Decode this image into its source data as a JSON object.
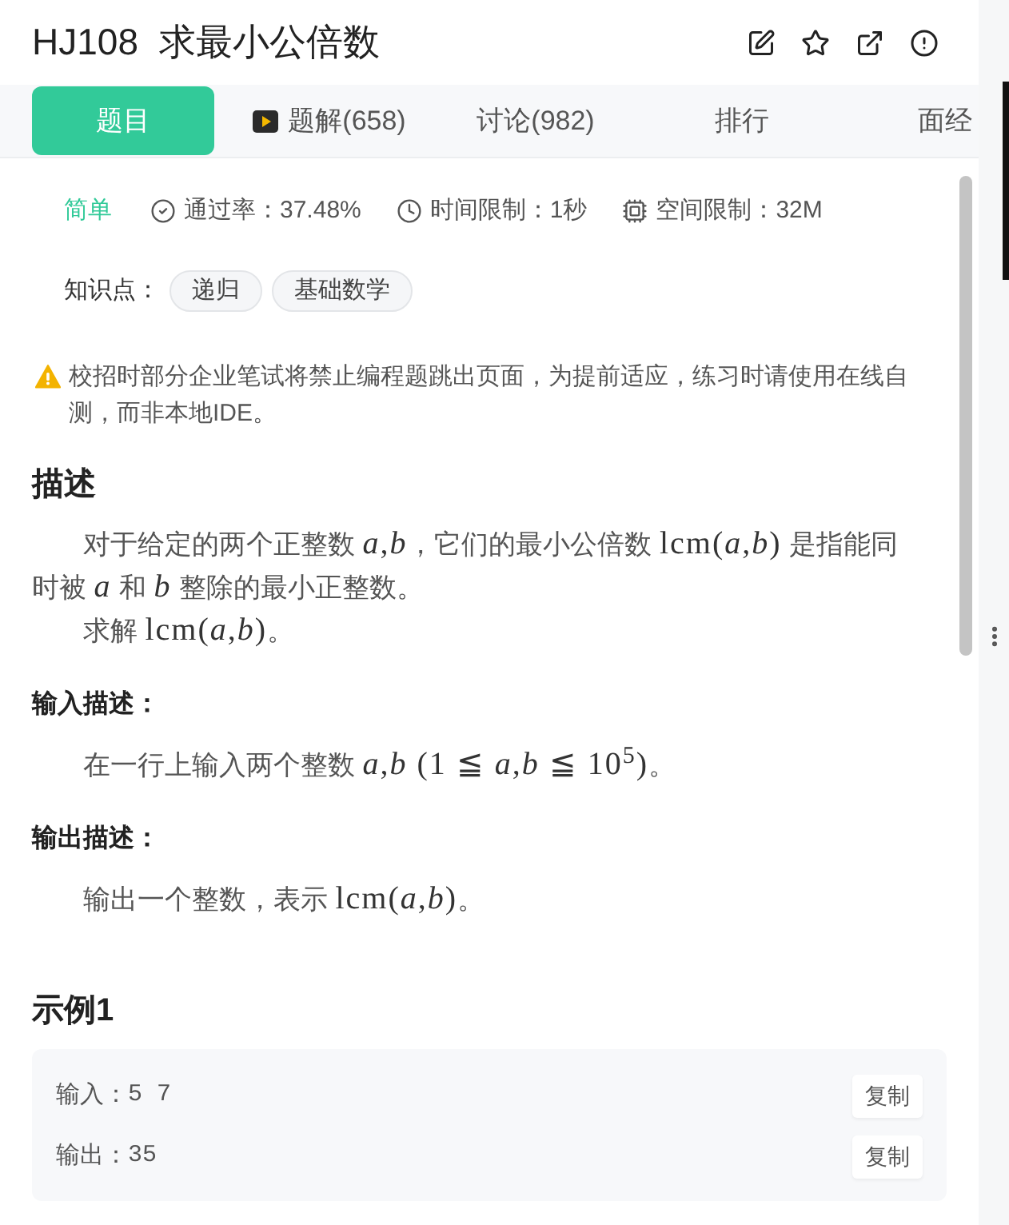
{
  "header": {
    "title": "HJ108  求最小公倍数"
  },
  "tabs": [
    {
      "label": "题目",
      "kind": "plain",
      "selected": true
    },
    {
      "label": "题解(658)",
      "kind": "video",
      "selected": false
    },
    {
      "label": "讨论(982)",
      "kind": "plain",
      "selected": false
    },
    {
      "label": "排行",
      "kind": "plain",
      "selected": false
    },
    {
      "label": "面经",
      "kind": "plain",
      "selected": false
    }
  ],
  "meta": {
    "difficulty": "简单",
    "stats": [
      {
        "kind": "pass_rate",
        "text": "通过率：37.48%"
      },
      {
        "kind": "time_limit",
        "text": "时间限制：1秒"
      },
      {
        "kind": "memory_limit",
        "text": "空间限制：32M"
      }
    ]
  },
  "knowledge": {
    "label": "知识点：",
    "tags": [
      "递归",
      "基础数学"
    ]
  },
  "notice": "校招时部分企业笔试将禁止编程题跳出页面，为提前适应，练习时请使用在线自测，而非本地IDE。",
  "sections": [
    {
      "kind": "major",
      "heading": "描述",
      "paragraphs": [
        [
          {
            "kind": "text",
            "text": "对于给定的两个正整数 "
          },
          {
            "kind": "math",
            "text": "*a*,*b*"
          },
          {
            "kind": "text",
            "text": "，它们的最小公倍数 "
          },
          {
            "kind": "math",
            "text": "lcm(*a*,*b*)"
          },
          {
            "kind": "text",
            "text": " 是指能同时被 "
          },
          {
            "kind": "math",
            "text": "*a*"
          },
          {
            "kind": "text",
            "text": " 和 "
          },
          {
            "kind": "math",
            "text": "*b*"
          },
          {
            "kind": "text",
            "text": " 整除的最小正整数。"
          }
        ],
        [
          {
            "kind": "text",
            "text": "求解 "
          },
          {
            "kind": "math",
            "text": "lcm(*a*,*b*)"
          },
          {
            "kind": "text",
            "text": "。"
          }
        ]
      ]
    },
    {
      "kind": "minor",
      "heading": "输入描述：",
      "paragraphs": [
        [
          {
            "kind": "text",
            "text": "在一行上输入两个整数 "
          },
          {
            "kind": "math",
            "text": "*a*,*b* (1 ≦ *a*,*b* ≦ 10$^{5}$)"
          },
          {
            "kind": "text",
            "text": "。"
          }
        ]
      ]
    },
    {
      "kind": "minor",
      "heading": "输出描述：",
      "paragraphs": [
        [
          {
            "kind": "text",
            "text": "输出一个整数，表示 "
          },
          {
            "kind": "math",
            "text": "lcm(*a*,*b*)"
          },
          {
            "kind": "text",
            "text": "。"
          }
        ]
      ]
    }
  ],
  "example": {
    "heading": "示例1",
    "rows": [
      {
        "label": "输入：",
        "value": "5 7",
        "button": "复制"
      },
      {
        "label": "输出：",
        "value": "35",
        "button": "复制"
      }
    ]
  }
}
